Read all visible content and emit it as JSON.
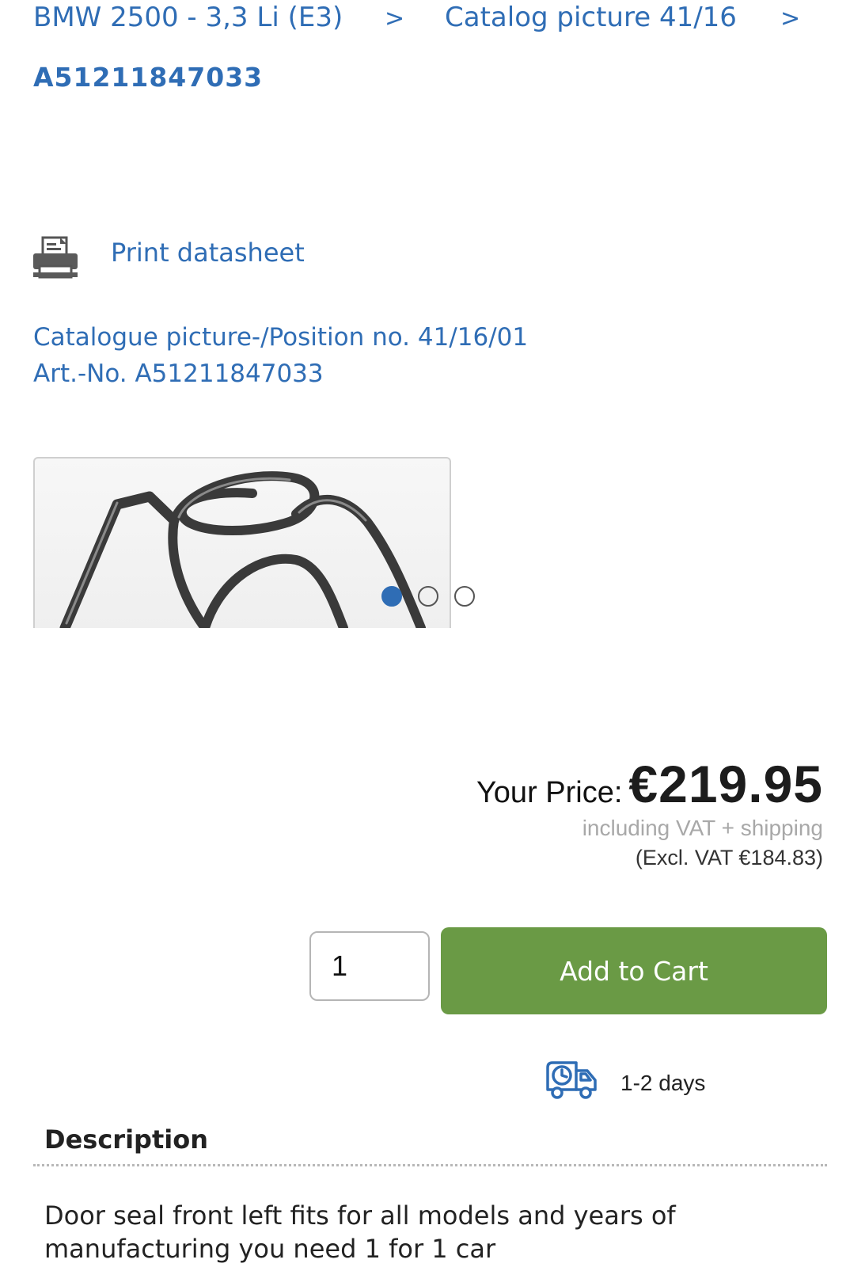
{
  "breadcrumb": {
    "items": [
      "BMW 2500 - 3,3 Li (E3)",
      "Catalog picture 41/16"
    ],
    "separator": ">"
  },
  "part": {
    "title": "A51211847033"
  },
  "print": {
    "label": "Print datasheet",
    "icon": "printer-icon"
  },
  "catalogue": {
    "position_line": "Catalogue picture-/Position no. 41/16/01",
    "article_line": "Art.-No. A51211847033"
  },
  "gallery": {
    "slide_count": 3,
    "active_index": 0
  },
  "pricing": {
    "label": "Your Price:",
    "value": "€219.95",
    "vat_note": "including VAT + shipping",
    "excl_vat": "(Excl. VAT €184.83)"
  },
  "cart": {
    "quantity": "1",
    "button_label": "Add to Cart"
  },
  "delivery": {
    "icon": "delivery-truck-icon",
    "time": "1-2 days"
  },
  "description": {
    "heading": "Description",
    "text": "Door seal front left fits for all models and years of manufacturing you need 1 for 1 car"
  },
  "colors": {
    "link_blue": "#2f6db5",
    "cart_green": "#6a9a45",
    "price_text": "#1c1c1c"
  }
}
